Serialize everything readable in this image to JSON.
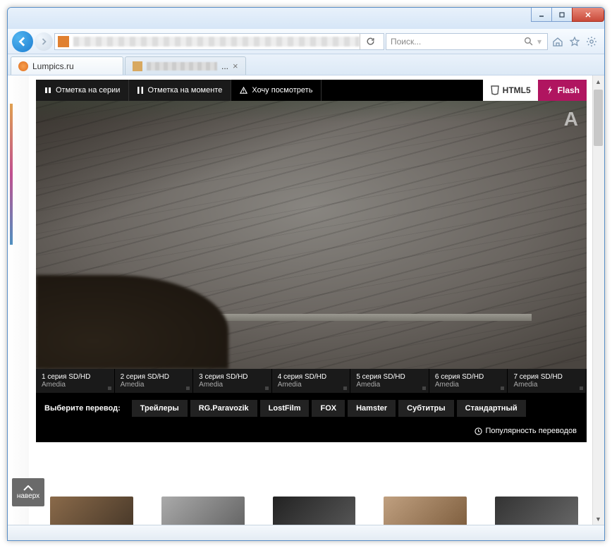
{
  "window": {
    "minimize": "_",
    "maximize": "☐",
    "close": "✕"
  },
  "nav": {
    "refresh": "↻",
    "search_placeholder": "Поиск...",
    "search_icon": "🔍"
  },
  "tabs": [
    {
      "title": "Lumpics.ru",
      "active": true
    },
    {
      "title": "...",
      "active": false,
      "blurred": true
    }
  ],
  "player": {
    "top_tabs": {
      "mark_series": "Отметка на серии",
      "mark_moment": "Отметка на моменте",
      "watch_later": "Хочу посмотреть"
    },
    "badges": {
      "html5": "HTML5",
      "flash": "Flash"
    },
    "watermark": "A"
  },
  "episodes": [
    {
      "line1": "1 серия SD/HD",
      "line2": "Amedia"
    },
    {
      "line1": "2 серия SD/HD",
      "line2": "Amedia"
    },
    {
      "line1": "3 серия SD/HD",
      "line2": "Amedia"
    },
    {
      "line1": "4 серия SD/HD",
      "line2": "Amedia"
    },
    {
      "line1": "5 серия SD/HD",
      "line2": "Amedia"
    },
    {
      "line1": "6 серия SD/HD",
      "line2": "Amedia"
    },
    {
      "line1": "7 серия SD/HD",
      "line2": "Amedia"
    }
  ],
  "translations": {
    "label": "Выберите перевод:",
    "options": [
      "Трейлеры",
      "RG.Paravozik",
      "LostFilm",
      "FOX",
      "Hamster",
      "Субтитры",
      "Стандартный"
    ],
    "popularity": "Популярность переводов"
  },
  "to_top": "наверх"
}
